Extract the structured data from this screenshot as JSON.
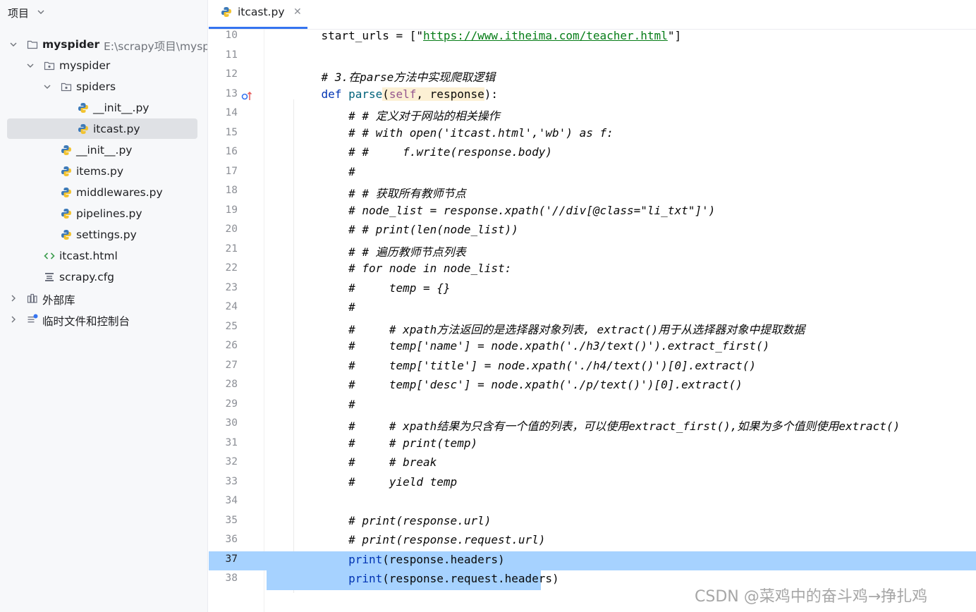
{
  "sidebar": {
    "title": "项目",
    "items": [
      {
        "label": "myspider",
        "path": "E:\\scrapy项目\\myspider"
      },
      {
        "label": "myspider"
      },
      {
        "label": "spiders"
      },
      {
        "label": "__init__.py"
      },
      {
        "label": "itcast.py"
      },
      {
        "label": "__init__.py"
      },
      {
        "label": "items.py"
      },
      {
        "label": "middlewares.py"
      },
      {
        "label": "pipelines.py"
      },
      {
        "label": "settings.py"
      },
      {
        "label": "itcast.html"
      },
      {
        "label": "scrapy.cfg"
      },
      {
        "label": "外部库"
      },
      {
        "label": "临时文件和控制台"
      }
    ]
  },
  "tab": {
    "label": "itcast.py",
    "close": "✕"
  },
  "editor": {
    "line_numbers": [
      "10",
      "11",
      "12",
      "13",
      "14",
      "15",
      "16",
      "17",
      "18",
      "19",
      "20",
      "21",
      "22",
      "23",
      "24",
      "25",
      "26",
      "27",
      "28",
      "29",
      "30",
      "31",
      "32",
      "33",
      "34",
      "35",
      "36",
      "37",
      "38"
    ],
    "l10": {
      "a": "    start_urls = [\"",
      "url": "https://www.itheima.com/teacher.html",
      "b": "\"]"
    },
    "l12": "    # 3.在parse方法中实现爬取逻辑",
    "l13": {
      "kw": "    def ",
      "fn": "parse",
      "p1": "(",
      "slf": "self",
      "p2": ", response",
      "p3": "):"
    },
    "l14": "        # # 定义对于网站的相关操作",
    "l15": "        # # with open('itcast.html','wb') as f:",
    "l16": "        # #     f.write(response.body)",
    "l17": "        #",
    "l18": "        # # 获取所有教师节点",
    "l19": "        # node_list = response.xpath('//div[@class=\"li_txt\"]')",
    "l20": "        # # print(len(node_list))",
    "l21": "        # # 遍历教师节点列表",
    "l22": "        # for node in node_list:",
    "l23": "        #     temp = {}",
    "l24": "        #",
    "l25": "        #     # xpath方法返回的是选择器对象列表, extract()用于从选择器对象中提取数据",
    "l26": "        #     temp['name'] = node.xpath('./h3/text()').extract_first()",
    "l27": "        #     temp['title'] = node.xpath('./h4/text()')[0].extract()",
    "l28": "        #     temp['desc'] = node.xpath('./p/text()')[0].extract()",
    "l29": "        #",
    "l30": "        #     # xpath结果为只含有一个值的列表，可以使用extract_first(),如果为多个值则使用extract()",
    "l31": "        #     # print(temp)",
    "l32": "        #     # break",
    "l33": "        #     yield temp",
    "l35": "        # print(response.url)",
    "l36": "        # print(response.request.url)",
    "l37": {
      "ind": "        ",
      "fn": "print",
      "rest": "(response.headers)"
    },
    "l38": {
      "ind": "        ",
      "fn": "print",
      "rest": "(response.request.headers)"
    }
  },
  "watermark": "CSDN @菜鸡中的奋斗鸡→挣扎鸡",
  "colors": {
    "accent": "#3574f0",
    "selection": "#a6d2ff",
    "keyword": "#0033b3",
    "comment": "#8c8c8c",
    "string": "#067d17"
  }
}
